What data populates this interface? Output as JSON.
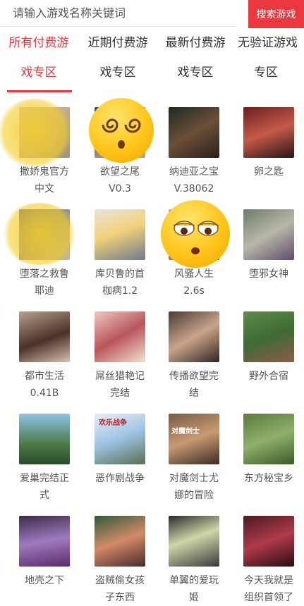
{
  "search": {
    "placeholder": "请输入游戏名称关键词",
    "button_label": "搜索游戏"
  },
  "tabs": [
    {
      "line1": "所有付费游",
      "line2": "戏专区"
    },
    {
      "line1": "近期付费游",
      "line2": "戏专区"
    },
    {
      "line1": "最新付费游",
      "line2": "戏专区"
    },
    {
      "line1": "无验证游戏",
      "line2": "专区"
    }
  ],
  "games": [
    {
      "line1": "撒娇鬼官方",
      "line2": "中文"
    },
    {
      "line1": "欲望之尾",
      "line2": "V0.3"
    },
    {
      "line1": "纳迪亚之宝",
      "line2": "V.38062"
    },
    {
      "line1": "卵之匙",
      "line2": ""
    },
    {
      "line1": "堕落之救鲁",
      "line2": "耶迪"
    },
    {
      "line1": "库贝鲁的首",
      "line2": "枷病1.2"
    },
    {
      "line1": "风骚人生",
      "line2": "2.6s"
    },
    {
      "line1": "堕邪女神",
      "line2": ""
    },
    {
      "line1": "都市生活",
      "line2": "0.41B"
    },
    {
      "line1": "屌丝猎艳记",
      "line2": "完结"
    },
    {
      "line1": "传播欲望完",
      "line2": "结"
    },
    {
      "line1": "野外合宿",
      "line2": ""
    },
    {
      "line1": "爱巢完结正",
      "line2": "式"
    },
    {
      "line1": "恶作剧战争",
      "line2": ""
    },
    {
      "line1": "对魔剑士尤",
      "line2": "娜的冒险"
    },
    {
      "line1": "东方秘宝乡",
      "line2": ""
    },
    {
      "line1": "地壳之下",
      "line2": ""
    },
    {
      "line1": "盗贼偷女孩",
      "line2": "子东西"
    },
    {
      "line1": "单翼的爱玩",
      "line2": "姬"
    },
    {
      "line1": "今天我就是",
      "line2": "组织首领了"
    }
  ],
  "thumb_text": {
    "game_13": "欢乐战争",
    "game_14": "对魔剑士"
  },
  "overlays": {
    "emoji_1": "dizzy-face-emoji",
    "emoji_2": "unamused-face-emoji"
  },
  "colors": {
    "accent": "#e9383f",
    "text": "#555555"
  }
}
